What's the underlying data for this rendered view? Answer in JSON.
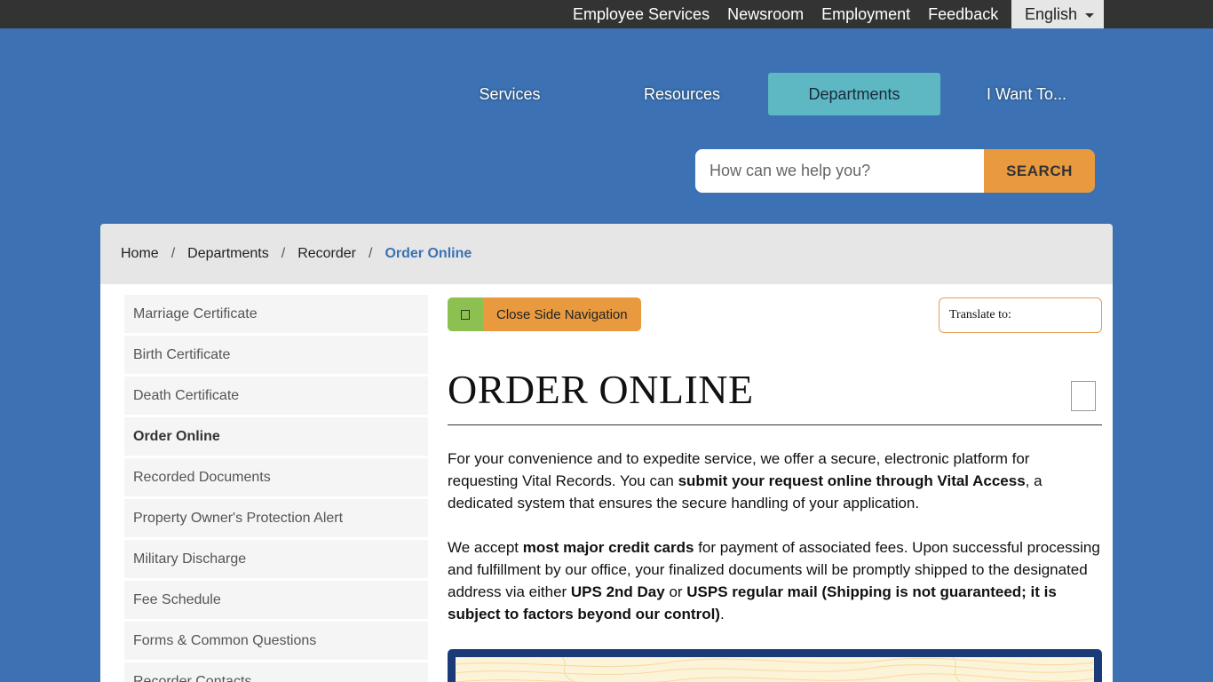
{
  "utility": {
    "links": [
      "Employee Services",
      "Newsroom",
      "Employment",
      "Feedback"
    ],
    "language": "English"
  },
  "nav": {
    "items": [
      "Services",
      "Resources",
      "Departments",
      "I Want To..."
    ],
    "active": "Departments"
  },
  "search": {
    "placeholder": "How can we help you?",
    "button": "SEARCH"
  },
  "breadcrumb": {
    "items": [
      "Home",
      "Departments",
      "Recorder"
    ],
    "separator": "/",
    "current": "Order Online"
  },
  "sidebar": {
    "items": [
      "Marriage Certificate",
      "Birth Certificate",
      "Death Certificate",
      "Order Online",
      "Recorded Documents",
      "Property Owner's Protection Alert",
      "Military Discharge",
      "Fee Schedule",
      "Forms & Common Questions",
      "Recorder Contacts"
    ],
    "active": "Order Online"
  },
  "toolbar": {
    "close_nav_label": "Close Side Navigation",
    "translate_label": "Translate to:"
  },
  "main": {
    "title": "ORDER ONLINE",
    "p1": {
      "a": "For your convenience and to expedite service, we offer a secure, electronic platform for requesting Vital Records. You can ",
      "b": "submit your request online through Vital Access",
      "c": ", a dedicated system that ensures the secure handling of your application."
    },
    "p2": {
      "a": "We accept ",
      "b": "most major credit cards",
      "c": " for payment of associated fees. Upon successful processing and fulfillment by our office, your finalized documents will be promptly shipped to the designated address via either ",
      "d": "UPS 2nd Day",
      "e": " or ",
      "f": "USPS regular mail (Shipping is not guaranteed; it is subject to factors beyond our control)",
      "g": "."
    }
  },
  "colors": {
    "page_bg": "#3c72b3",
    "utility_bar": "#333333",
    "nav_active": "#5db8c3",
    "accent_orange": "#e99a3f",
    "accent_green": "#8cc152",
    "link_blue": "#3c72b3",
    "map_border": "#1a3a78"
  }
}
